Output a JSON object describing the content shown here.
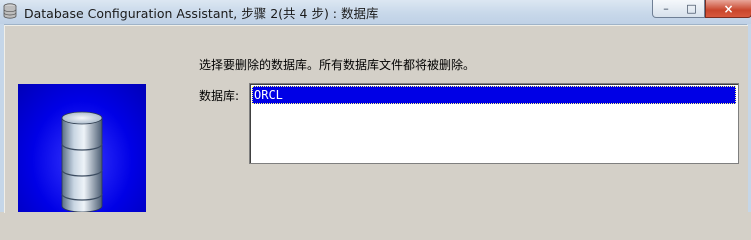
{
  "window": {
    "title": "Database Configuration Assistant, 步骤 2(共 4 步) : 数据库",
    "controls": {
      "minimize": "–",
      "maximize": "□",
      "close": "×"
    }
  },
  "page": {
    "instruction": "选择要删除的数据库。所有数据库文件都将被删除。",
    "database_label": "数据库:",
    "databases": [
      {
        "name": "ORCL",
        "selected": true
      }
    ]
  },
  "theme": {
    "selection_color": "#0000e6",
    "dialog_background": "#d4d0c8"
  },
  "icons": {
    "app": "database-app-icon",
    "illustration": "database-cylinder-icon"
  }
}
